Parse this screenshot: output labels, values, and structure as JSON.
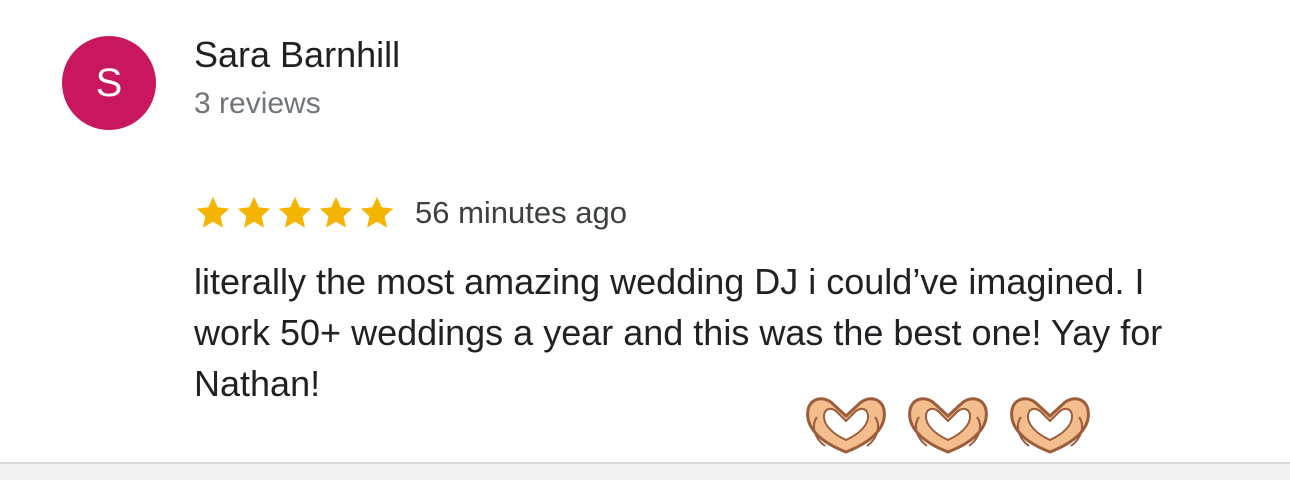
{
  "review": {
    "author": {
      "initial": "S",
      "name": "Sara Barnhill",
      "meta": "3 reviews",
      "avatar_color": "#c8175e"
    },
    "rating": 5,
    "max_rating": 5,
    "star_color": "#f5b400",
    "time_ago": "56 minutes ago",
    "text": "literally the most amazing wedding DJ i could’ve imagined. I work 50+ weddings a year and this was the best one! Yay for Nathan!",
    "emoji": [
      "heart-hands",
      "heart-hands",
      "heart-hands"
    ]
  }
}
